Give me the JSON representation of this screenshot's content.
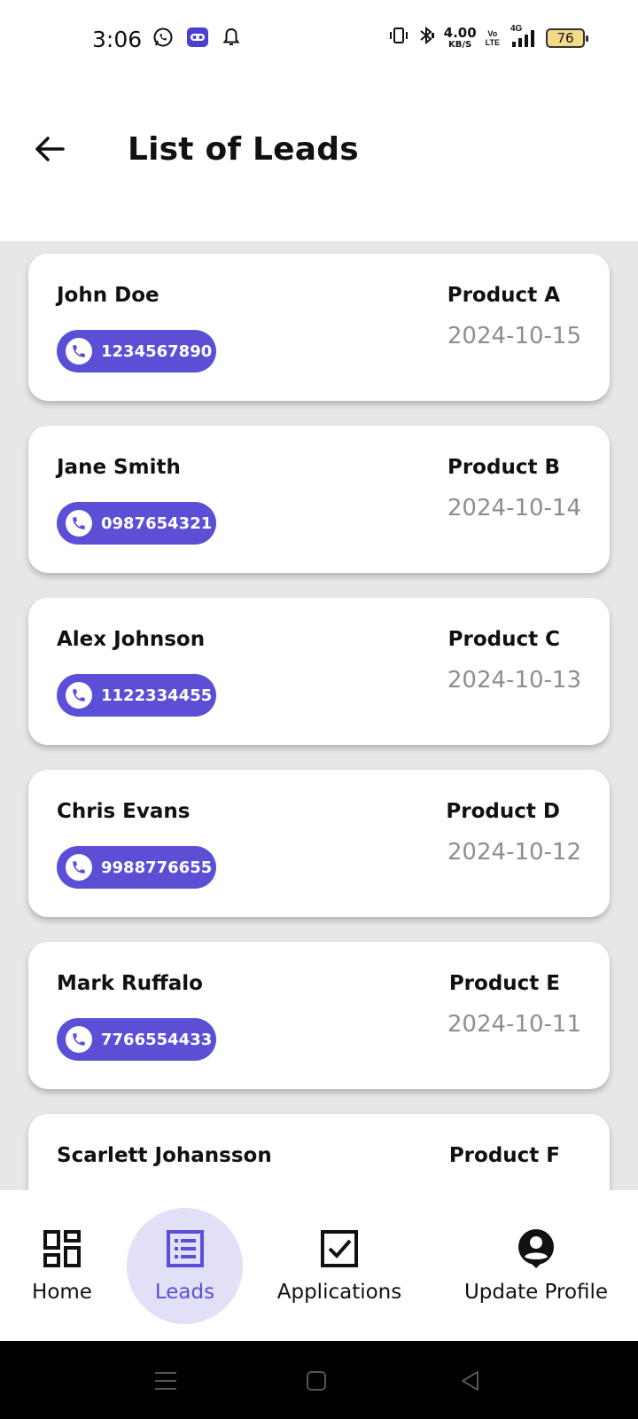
{
  "status_bar": {
    "time": "3:06",
    "network_speed_value": "4.00",
    "network_speed_unit": "KB/S",
    "volte_top": "Vo",
    "volte_bottom": "LTE",
    "network_type": "4G",
    "battery_level": "76"
  },
  "header": {
    "title": "List of Leads"
  },
  "leads": [
    {
      "name": "John Doe",
      "phone": "1234567890",
      "product": "Product A",
      "date": "2024-10-15"
    },
    {
      "name": "Jane Smith",
      "phone": "0987654321",
      "product": "Product B",
      "date": "2024-10-14"
    },
    {
      "name": "Alex Johnson",
      "phone": "1122334455",
      "product": "Product C",
      "date": "2024-10-13"
    },
    {
      "name": "Chris Evans",
      "phone": "9988776655",
      "product": "Product D",
      "date": "2024-10-12"
    },
    {
      "name": "Mark Ruffalo",
      "phone": "7766554433",
      "product": "Product E",
      "date": "2024-10-11"
    },
    {
      "name": "Scarlett Johansson",
      "product": "Product F"
    }
  ],
  "bottom_nav": {
    "items": [
      {
        "label": "Home",
        "icon": "dashboard-icon"
      },
      {
        "label": "Leads",
        "icon": "list-icon",
        "active": true
      },
      {
        "label": "Applications",
        "icon": "checkbox-icon"
      },
      {
        "label": "Update Profile",
        "icon": "account-icon"
      }
    ]
  },
  "colors": {
    "accent": "#5b4fd6",
    "accent_light": "#e1e0f7",
    "list_background": "#e7e7e7",
    "date_text": "#8e8e8e"
  }
}
